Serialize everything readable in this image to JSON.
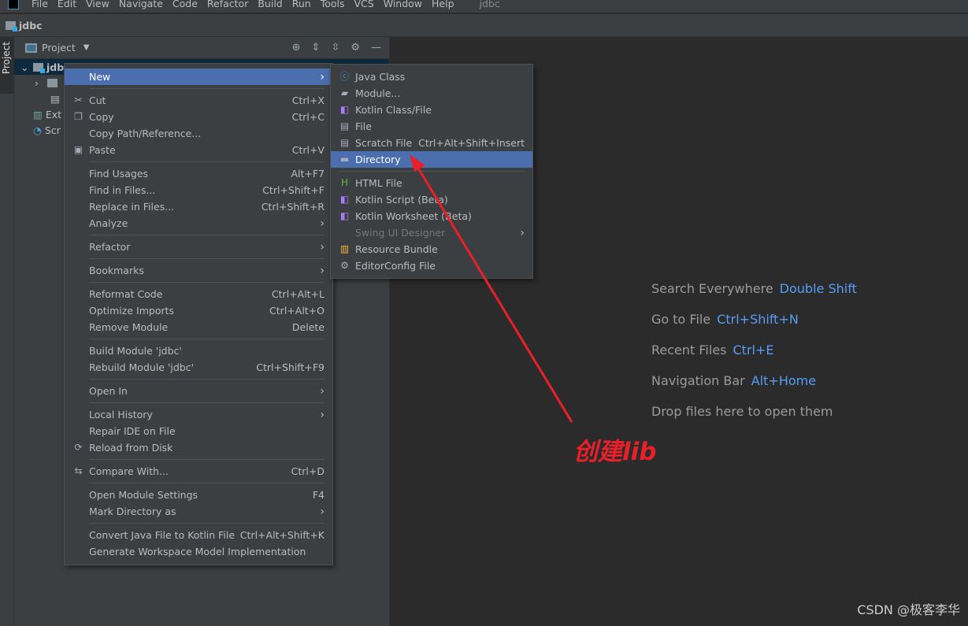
{
  "menubar": [
    "File",
    "Edit",
    "View",
    "Navigate",
    "Code",
    "Refactor",
    "Build",
    "Run",
    "Tools",
    "VCS",
    "Window",
    "Help",
    "jdbc"
  ],
  "navbar": {
    "project": "jdbc"
  },
  "strip": {
    "tab": "Project"
  },
  "panel": {
    "title": "Project",
    "tree": [
      "jdbc",
      "",
      "",
      "Ext",
      "Scr"
    ]
  },
  "context_menu": [
    {
      "label": "New",
      "arrow": true,
      "hl": true
    },
    "sep",
    {
      "label": "Cut",
      "shortcut": "Ctrl+X",
      "icon": "scissors-icon",
      "glyph": "✂"
    },
    {
      "label": "Copy",
      "shortcut": "Ctrl+C",
      "icon": "copy-icon",
      "glyph": "❐"
    },
    {
      "label": "Copy Path/Reference..."
    },
    {
      "label": "Paste",
      "shortcut": "Ctrl+V",
      "icon": "paste-icon",
      "glyph": "▣"
    },
    "sep",
    {
      "label": "Find Usages",
      "shortcut": "Alt+F7"
    },
    {
      "label": "Find in Files...",
      "shortcut": "Ctrl+Shift+F"
    },
    {
      "label": "Replace in Files...",
      "shortcut": "Ctrl+Shift+R"
    },
    {
      "label": "Analyze",
      "arrow": true
    },
    "sep",
    {
      "label": "Refactor",
      "arrow": true
    },
    "sep",
    {
      "label": "Bookmarks",
      "arrow": true
    },
    "sep",
    {
      "label": "Reformat Code",
      "shortcut": "Ctrl+Alt+L"
    },
    {
      "label": "Optimize Imports",
      "shortcut": "Ctrl+Alt+O"
    },
    {
      "label": "Remove Module",
      "shortcut": "Delete"
    },
    "sep",
    {
      "label": "Build Module 'jdbc'"
    },
    {
      "label": "Rebuild Module 'jdbc'",
      "shortcut": "Ctrl+Shift+F9"
    },
    "sep",
    {
      "label": "Open In",
      "arrow": true
    },
    "sep",
    {
      "label": "Local History",
      "arrow": true
    },
    {
      "label": "Repair IDE on File"
    },
    {
      "label": "Reload from Disk",
      "icon": "reload-icon",
      "glyph": "⟳"
    },
    "sep",
    {
      "label": "Compare With...",
      "shortcut": "Ctrl+D",
      "icon": "compare-icon",
      "glyph": "⇆"
    },
    "sep",
    {
      "label": "Open Module Settings",
      "shortcut": "F4"
    },
    {
      "label": "Mark Directory as",
      "arrow": true
    },
    "sep",
    {
      "label": "Convert Java File to Kotlin File",
      "shortcut": "Ctrl+Alt+Shift+K"
    },
    {
      "label": "Generate Workspace Model Implementation"
    }
  ],
  "new_submenu": [
    {
      "label": "Java Class",
      "icon": "java-class-icon",
      "glyph": "ⓒ",
      "color": "#3592c4"
    },
    {
      "label": "Module...",
      "icon": "module-icon",
      "glyph": "▰"
    },
    {
      "label": "Kotlin Class/File",
      "icon": "kotlin-file-icon",
      "glyph": "◧",
      "color": "#a97bff"
    },
    {
      "label": "File",
      "icon": "file-icon",
      "glyph": "▤"
    },
    {
      "label": "Scratch File",
      "shortcut": "Ctrl+Alt+Shift+Insert",
      "icon": "scratch-file-icon",
      "glyph": "▤"
    },
    {
      "label": "Directory",
      "icon": "folder-icon",
      "glyph": "▬",
      "hl": true
    },
    "sep",
    {
      "label": "HTML File",
      "icon": "html-file-icon",
      "glyph": "H",
      "color": "#62b543"
    },
    {
      "label": "Kotlin Script (Beta)",
      "icon": "kotlin-script-icon",
      "glyph": "◧",
      "color": "#a97bff"
    },
    {
      "label": "Kotlin Worksheet (Beta)",
      "icon": "kotlin-worksheet-icon",
      "glyph": "◧",
      "color": "#a97bff"
    },
    {
      "label": "Swing UI Designer",
      "arrow": true,
      "disabled": true
    },
    {
      "label": "Resource Bundle",
      "icon": "resource-bundle-icon",
      "glyph": "▥",
      "color": "#f4af3d"
    },
    {
      "label": "EditorConfig File",
      "icon": "gear-icon",
      "glyph": "⚙"
    }
  ],
  "hints": [
    {
      "label": "Search Everywhere",
      "shortcut": "Double Shift"
    },
    {
      "label": "Go to File",
      "shortcut": "Ctrl+Shift+N"
    },
    {
      "label": "Recent Files",
      "shortcut": "Ctrl+E"
    },
    {
      "label": "Navigation Bar",
      "shortcut": "Alt+Home"
    },
    {
      "label": "Drop files here to open them",
      "shortcut": ""
    }
  ],
  "annotation": "创建lib",
  "watermark": "CSDN @极客李华",
  "colors": {
    "highlight": "#4b6eaf",
    "annotation": "#e8202a",
    "shortcut": "#589df6"
  }
}
